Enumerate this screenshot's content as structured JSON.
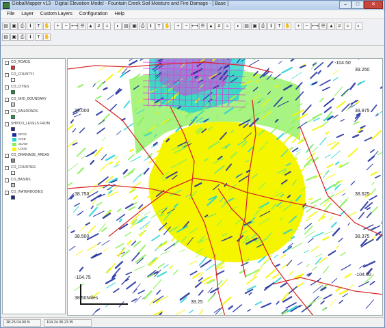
{
  "window": {
    "title": "GlobalMapper v13 - Digital Elevation Model - Fountain Creek Soil Moisture and Fire Damage - [ Base ]",
    "controls": {
      "minimize": "–",
      "maximize": "□",
      "close": "✕"
    }
  },
  "menubar": {
    "items": [
      "File",
      "Layer",
      "Custom Layers",
      "Configuration",
      "Help"
    ]
  },
  "toolbar": {
    "icons": [
      "open-icon",
      "save-icon",
      "print-icon",
      "info-icon",
      "text-icon",
      "pan-icon",
      "zoom-in-icon",
      "zoom-out-icon",
      "measure-icon",
      "layer-icon",
      "terrain-icon",
      "grid-icon",
      "contour-icon",
      "shade-icon"
    ]
  },
  "layers": [
    {
      "name": "CO_ROADS",
      "symbol_color": "#e23030"
    },
    {
      "name": "CO_COUNTY1",
      "symbol_color": "#ffffff"
    },
    {
      "name": "CO_CITIES",
      "symbol_color": "#1a8a3a"
    },
    {
      "name": "CO_NHD_BOUNDARY",
      "symbol_color": "#d0d0d0"
    },
    {
      "name": "CO_RAILROADS",
      "symbol_color": "#2aa04a"
    },
    {
      "name": "SHP/CO_LEVELS FROM",
      "symbol_color": "#1f2a9e"
    },
    {
      "name": "CO_DRAINAGE_AREAS",
      "symbol_color": "#888888"
    },
    {
      "name": "CO_COUNTIES",
      "symbol_color": "#ffffff"
    },
    {
      "name": "CO_BASINS",
      "symbol_color": "#cccccc"
    },
    {
      "name": "CO_WATERBODIES",
      "symbol_color": "#1a2a80"
    }
  ],
  "legend": {
    "items": [
      {
        "label": "BPCE",
        "color": "#1a2a9e"
      },
      {
        "label": "CICE",
        "color": "#22d3d3"
      },
      {
        "label": "SCAW",
        "color": "#8af05a"
      },
      {
        "label": "LOGE",
        "color": "#f5f500"
      }
    ]
  },
  "map": {
    "coords": [
      "-104.50",
      "39.250",
      "39.000",
      "38.875",
      "38.750",
      "38.625",
      "38.500",
      "38.375",
      "-104.75",
      "-104.00",
      "38.50",
      "39.25"
    ],
    "scale_label": "Miles",
    "colors": {
      "yellow": "#f5f500",
      "cyan": "#22d3d3",
      "green": "#8af05a",
      "blue": "#1a2a9e",
      "magenta": "#d93fd9",
      "road": "#d62828"
    }
  },
  "status": {
    "cell1": "38.25 04.00 N",
    "cell2": "104.24 05.23 W"
  }
}
